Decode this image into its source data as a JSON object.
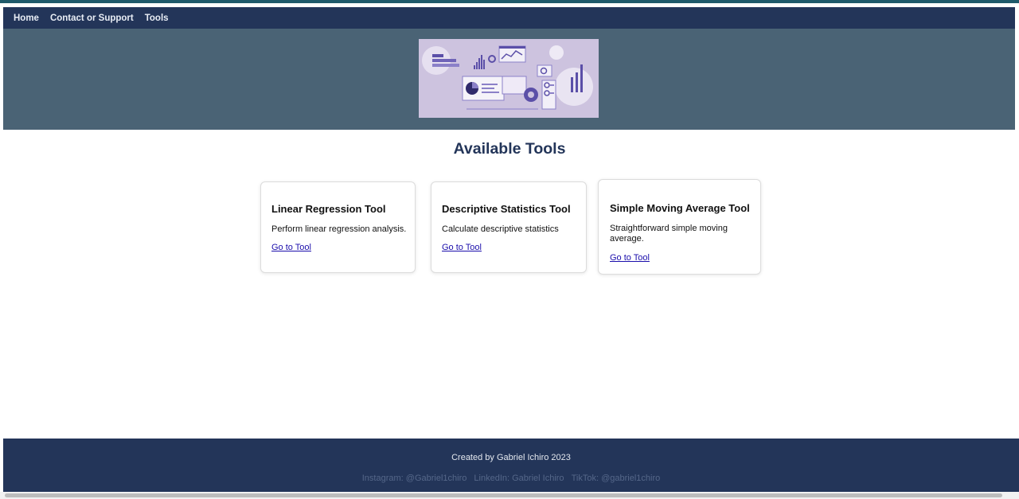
{
  "nav": {
    "items": [
      {
        "label": "Home"
      },
      {
        "label": "Contact or Support"
      },
      {
        "label": "Tools"
      }
    ]
  },
  "main": {
    "heading": "Available Tools",
    "cards": [
      {
        "title": "Linear Regression Tool",
        "description": "Perform linear regression analysis.",
        "link": "Go to Tool"
      },
      {
        "title": "Descriptive Statistics Tool",
        "description": "Calculate descriptive statistics",
        "link": "Go to Tool"
      },
      {
        "title": "Simple Moving Average Tool",
        "description": "Straightforward simple moving average.",
        "link": "Go to Tool"
      }
    ]
  },
  "footer": {
    "credit": "Created by Gabriel Ichiro 2023",
    "social": [
      "Instagram: @Gabriel1chiro",
      "LinkedIn: Gabriel Ichiro",
      "TikTok: @gabriel1chiro"
    ]
  },
  "colors": {
    "nav_bg": "#233559",
    "hero_bg": "#4a6375",
    "heading": "#233559",
    "link": "#1a0dab",
    "banner_bg": "#cdc3df",
    "banner_accent": "#5b4fa8"
  },
  "icons": [
    "dashboard-illustration"
  ]
}
